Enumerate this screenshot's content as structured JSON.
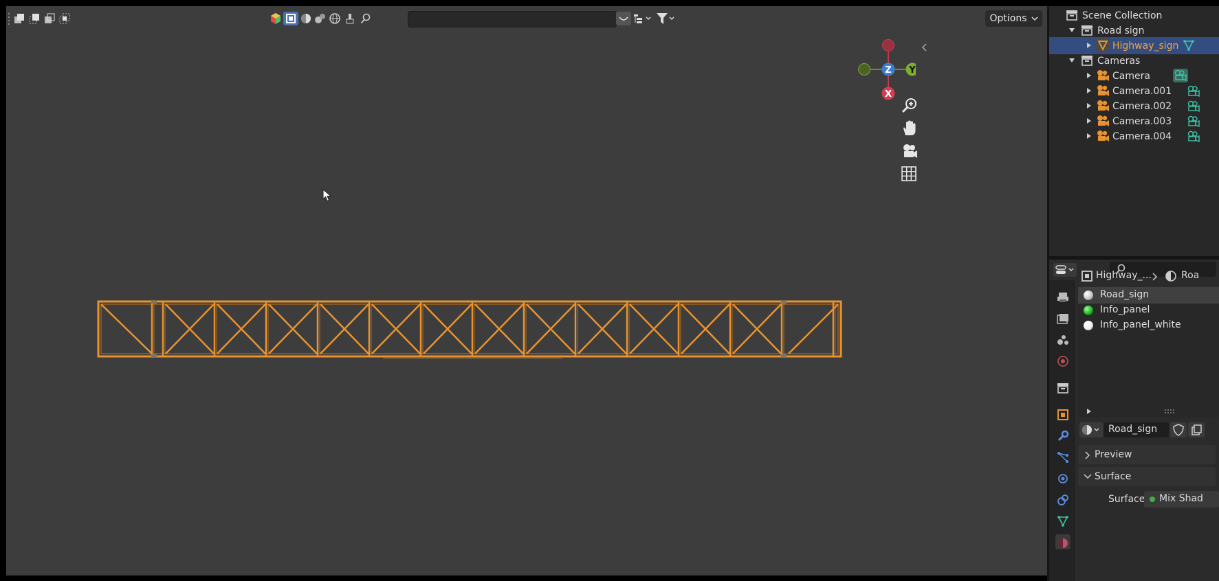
{
  "viewport": {
    "header": {
      "search_placeholder": "",
      "options_label": "Options"
    },
    "gizmo": {
      "z": "Z",
      "y": "Y",
      "x": "X"
    },
    "object_color": "#e8932f"
  },
  "outliner": {
    "root": "Scene Collection",
    "items": [
      {
        "label": "Road sign"
      },
      {
        "label": "Highway_sign"
      },
      {
        "label": "Cameras"
      },
      {
        "label": "Camera"
      },
      {
        "label": "Camera.001"
      },
      {
        "label": "Camera.002"
      },
      {
        "label": "Camera.003"
      },
      {
        "label": "Camera.004"
      }
    ]
  },
  "properties": {
    "search_placeholder": "",
    "breadcrumb": {
      "object": "Highway_...",
      "material": "Roa"
    },
    "material_slots": [
      {
        "label": "Road_sign",
        "color": "#c8c8c8"
      },
      {
        "label": "Info_panel",
        "color": "#22b422"
      },
      {
        "label": "Info_panel_white",
        "color": "#f0f0f0"
      }
    ],
    "material_name": "Road_sign",
    "sections": {
      "preview": "Preview",
      "surface": "Surface"
    },
    "surface_field_label": "Surface",
    "surface_value": "Mix Shad"
  }
}
